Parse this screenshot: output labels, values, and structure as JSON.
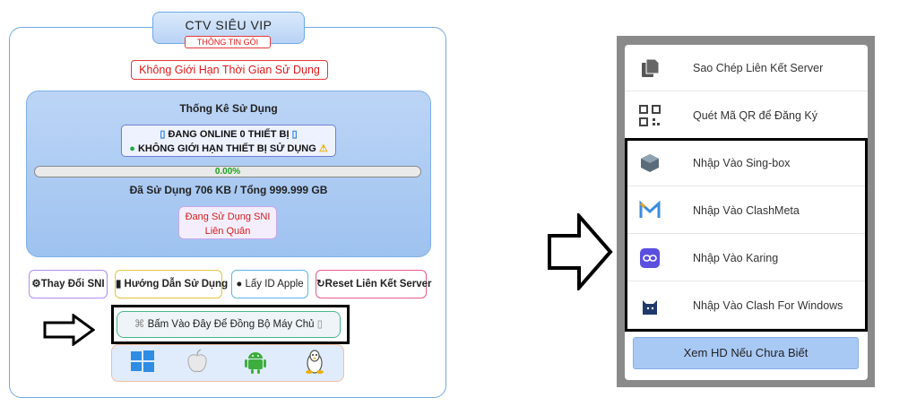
{
  "left_panel": {
    "title": "CTV SIÊU VIP",
    "subtitle": "THÔNG TIN GÓI",
    "unlimited_time": "Không Giới Hạn Thời Gian Sử Dụng",
    "stats_title": "Thống Kê Sử Dụng",
    "online_line": "ĐANG ONLINE 0 THIẾT BỊ",
    "device_limit_line": "KHÔNG GIỚI HẠN THIẾT BỊ SỬ DỤNG",
    "progress_percent": 0.0,
    "progress_label": "0.00%",
    "usage_text": "Đã Sử Dụng 706 KB / Tổng 999.999 GB",
    "sni_line1": "Đang Sử Dụng SNI",
    "sni_line2": "Liên Quân",
    "buttons": {
      "change_sni": "Thay Đổi SNI",
      "guide": "Hướng Dẫn Sử Dụng",
      "apple_id": "Lấy ID Apple",
      "reset": "Reset Liên Kết Server"
    },
    "sync_button": "Bấm Vào Đây Để Đồng Bộ Máy Chủ",
    "os_icons": [
      "windows-icon",
      "apple-icon",
      "android-icon",
      "linux-icon"
    ]
  },
  "right_panel": {
    "menu_items": [
      {
        "label": "Sao Chép Liên Kết Server",
        "icon": "copy-icon"
      },
      {
        "label": "Quét Mã QR để Đăng Ký",
        "icon": "qr-code-icon"
      },
      {
        "label": "Nhập Vào Sing-box",
        "icon": "sing-box-icon"
      },
      {
        "label": "Nhập Vào ClashMeta",
        "icon": "clashmeta-icon"
      },
      {
        "label": "Nhập Vào Karing",
        "icon": "karing-icon"
      },
      {
        "label": "Nhập Vào Clash For Windows",
        "icon": "clash-for-windows-icon"
      }
    ],
    "help_button": "Xem HD Nếu Chưa Biết"
  },
  "colors": {
    "accent_blue": "#6fa8e6",
    "alert_red": "#e01919",
    "progress_green": "#19a319",
    "help_button_bg": "#a9c9f5"
  }
}
